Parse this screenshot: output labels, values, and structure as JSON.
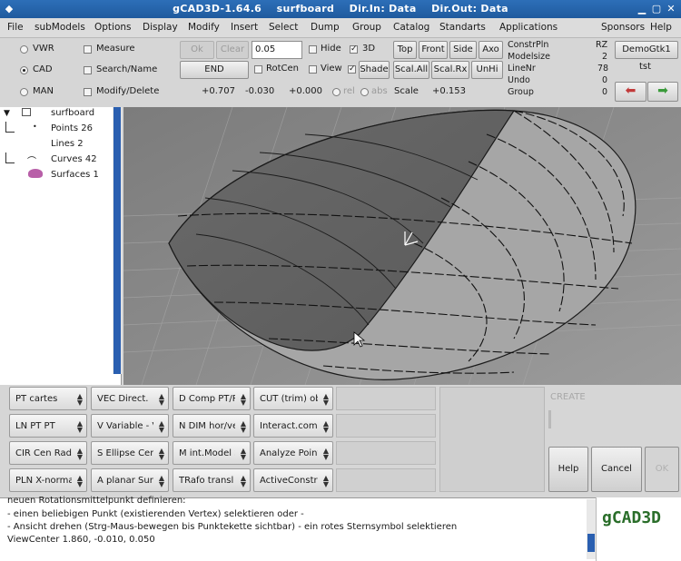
{
  "window": {
    "app_name": "gCAD3D-1.64.6",
    "file": "surfboard",
    "dir_in": "Dir.In: Data",
    "dir_out": "Dir.Out: Data"
  },
  "menu": [
    "File",
    "subModels",
    "Options",
    "Display",
    "Modify",
    "Insert",
    "Select",
    "Dump",
    "Group",
    "Catalog",
    "Standarts",
    "Applications",
    "Sponsors",
    "Help"
  ],
  "modes": [
    {
      "label": "VWR",
      "selected": false
    },
    {
      "label": "CAD",
      "selected": true
    },
    {
      "label": "MAN",
      "selected": false
    }
  ],
  "checks": [
    "Measure",
    "Search/Name",
    "Modify/Delete"
  ],
  "toolbar": {
    "btn1": "Ok",
    "btn2": "Clear",
    "value": "0.05",
    "hide": "Hide",
    "three_d": "3D",
    "end": "END",
    "rotcen": "RotCen",
    "view": "View",
    "shade": "Shade",
    "top": "Top",
    "front": "Front",
    "side": "Side",
    "axo": "Axo",
    "scal_all": "Scal.All",
    "scal_rx": "Scal.Rx",
    "unhi": "UnHi",
    "coord_x": "+0.707",
    "coord_y": "-0.030",
    "coord_z": "+0.000",
    "rel": "rel",
    "abs": "abs",
    "scale_label": "Scale",
    "scale_value": "+0.153"
  },
  "info": {
    "rows": [
      {
        "label": "ConstrPln",
        "value": "RZ"
      },
      {
        "label": "Modelsize",
        "value": "2"
      },
      {
        "label": "LineNr",
        "value": "78"
      },
      {
        "label": "Undo",
        "value": "0"
      },
      {
        "label": "Group",
        "value": "0"
      }
    ],
    "demo_button": "DemoGtk1",
    "tst": "tst"
  },
  "tree": [
    {
      "label": "surfboard"
    },
    {
      "label": "Points 26"
    },
    {
      "label": "Lines 2"
    },
    {
      "label": "Curves 42"
    },
    {
      "label": "Surfaces 1"
    }
  ],
  "combos": [
    [
      "PT cartes",
      "VEC Direct.",
      "D Comp PT/P",
      "CUT (trim) ob"
    ],
    [
      "LN PT PT",
      "V Variable - V",
      "N DIM hor/ve",
      "Interact.com"
    ],
    [
      "CIR Cen Radi",
      "S Ellipse Cent",
      "M int.Model S",
      "Analyze Point"
    ],
    [
      "PLN X-normal",
      "A planar Surf",
      "TRafo transl",
      "ActiveConstr"
    ]
  ],
  "right_panel": {
    "label": "CREATE",
    "help": "Help",
    "cancel": "Cancel",
    "ok": "OK"
  },
  "messages": [
    "neuen Rotationsmittelpunkt definieren:",
    "- einen beliebigen Punkt (existierenden Vertex) selektieren oder -",
    "- Ansicht drehen (Strg-Maus-bewegen bis Punktekette sichtbar) - ein rotes Sternsymbol selektieren",
    "ViewCenter    1.860,  -0.010,   0.050"
  ],
  "logo": "gCAD3D",
  "colors": {
    "titlebar": "#1f5a9e",
    "viewport_bg": "#8c8c8c",
    "logo": "#2a6e2a",
    "arrow_left": "#c23a3a",
    "arrow_right": "#3a9a3a"
  }
}
